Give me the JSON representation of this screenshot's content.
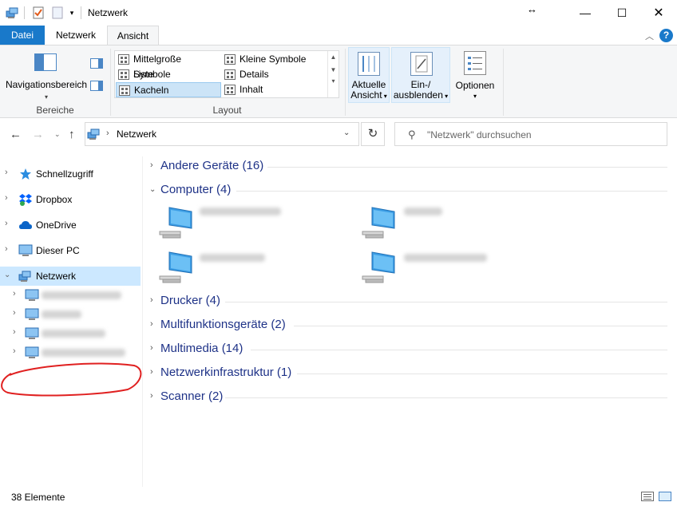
{
  "window": {
    "title": "Netzwerk"
  },
  "ribbon_tabs": [
    {
      "label": "Datei"
    },
    {
      "label": "Netzwerk"
    },
    {
      "label": "Ansicht"
    }
  ],
  "ribbon": {
    "bereiche": {
      "navpane_label": "Navigationsbereich",
      "group_label": "Bereiche"
    },
    "layout": {
      "group_label": "Layout",
      "items": [
        {
          "label": "Mittelgroße Symbole"
        },
        {
          "label": "Kleine Symbole"
        },
        {
          "label": "Liste"
        },
        {
          "label": "Details"
        },
        {
          "label": "Kacheln",
          "selected": true
        },
        {
          "label": "Inhalt"
        }
      ]
    },
    "aktuelle_ansicht": {
      "line1": "Aktuelle",
      "line2": "Ansicht"
    },
    "ein_ausblenden": {
      "line1": "Ein-/",
      "line2": "ausblenden"
    },
    "optionen": {
      "label": "Optionen"
    }
  },
  "address": {
    "path": "Netzwerk",
    "search_placeholder": "\"Netzwerk\" durchsuchen"
  },
  "nav_pane": {
    "items": [
      {
        "label": "Schnellzugriff",
        "icon": "star-icon"
      },
      {
        "label": "Dropbox",
        "icon": "dropbox-icon"
      },
      {
        "label": "OneDrive",
        "icon": "cloud-icon"
      },
      {
        "label": "Dieser PC",
        "icon": "computer-icon"
      },
      {
        "label": "Netzwerk",
        "icon": "network-icon",
        "selected": true
      }
    ]
  },
  "groups": [
    {
      "label": "Andere Geräte (16)",
      "expanded": false
    },
    {
      "label": "Computer (4)",
      "expanded": true
    },
    {
      "label": "Drucker (4)",
      "expanded": false
    },
    {
      "label": "Multifunktionsgeräte (2)",
      "expanded": false
    },
    {
      "label": "Multimedia (14)",
      "expanded": false
    },
    {
      "label": "Netzwerkinfrastruktur (1)",
      "expanded": false
    },
    {
      "label": "Scanner (2)",
      "expanded": false
    }
  ],
  "status": {
    "item_count": "38 Elemente"
  },
  "colors": {
    "accent": "#1979ca",
    "group_header": "#1e3287",
    "selection": "#cce8ff",
    "annotation": "#e02020"
  }
}
